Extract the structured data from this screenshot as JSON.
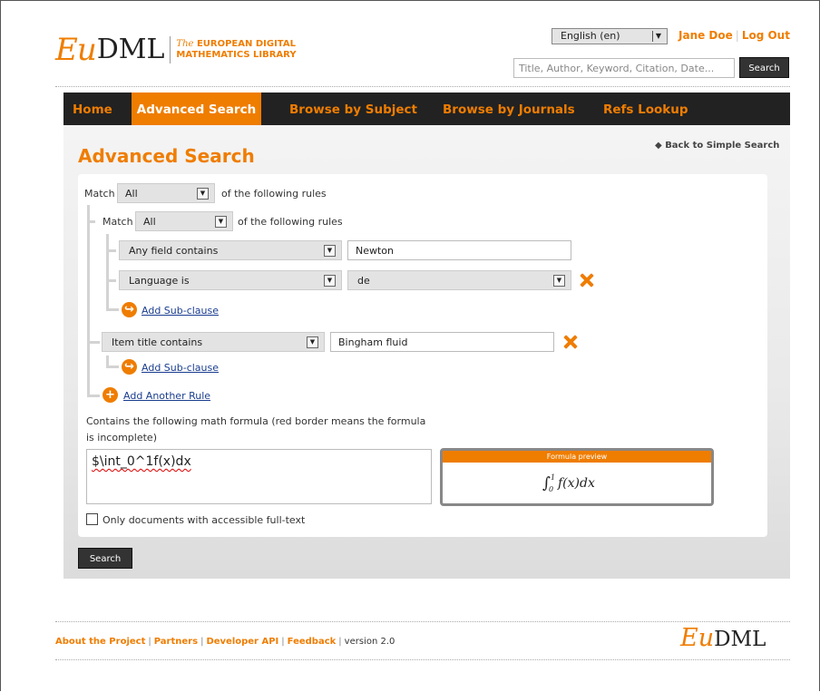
{
  "header": {
    "logo_eu": "Eu",
    "logo_dml": "DML",
    "tagline_the": "The",
    "tagline_1": "EUROPEAN DIGITAL",
    "tagline_2": "MATHEMATICS LIBRARY",
    "language": "English (en)",
    "user": "Jane Doe",
    "logout": "Log Out",
    "search_placeholder": "Title, Author, Keyword, Citation, Date...",
    "search_button": "Search"
  },
  "nav": {
    "items": [
      "Home",
      "Advanced Search",
      "Browse by Subject",
      "Browse by Journals",
      "Refs Lookup"
    ],
    "active": "Advanced Search"
  },
  "page": {
    "title": "Advanced Search",
    "back_link": "Back to Simple Search"
  },
  "query": {
    "match_label": "Match",
    "match_value": "All",
    "following_rules": "of the following rules",
    "sub_match_label": "Match",
    "sub_match_value": "All",
    "sub_following_rules": "of the following rules",
    "rule1_field": "Any field contains",
    "rule1_value": "Newton",
    "rule2_field": "Language is",
    "rule2_value": "de",
    "add_subclause_1": "Add Sub-clause",
    "rule3_field": "Item title contains",
    "rule3_value": "Bingham fluid",
    "add_subclause_2": "Add Sub-clause",
    "add_another_rule": "Add Another Rule"
  },
  "formula": {
    "label_1": "Contains the following math formula (red border means the formula",
    "label_2": "is incomplete)",
    "value": "$\\int_0^1f(x)dx",
    "preview_title": "Formula preview"
  },
  "fulltext_label": "Only documents with accessible full-text",
  "search_button": "Search",
  "footer": {
    "links": [
      "About the Project",
      "Partners",
      "Developer API",
      "Feedback"
    ],
    "version": "version 2.0",
    "logo_eu": "Eu",
    "logo_dml": "DML"
  },
  "colors": {
    "accent": "#ef7d00",
    "nav_bg": "#222222",
    "link": "#1a3d8f"
  }
}
